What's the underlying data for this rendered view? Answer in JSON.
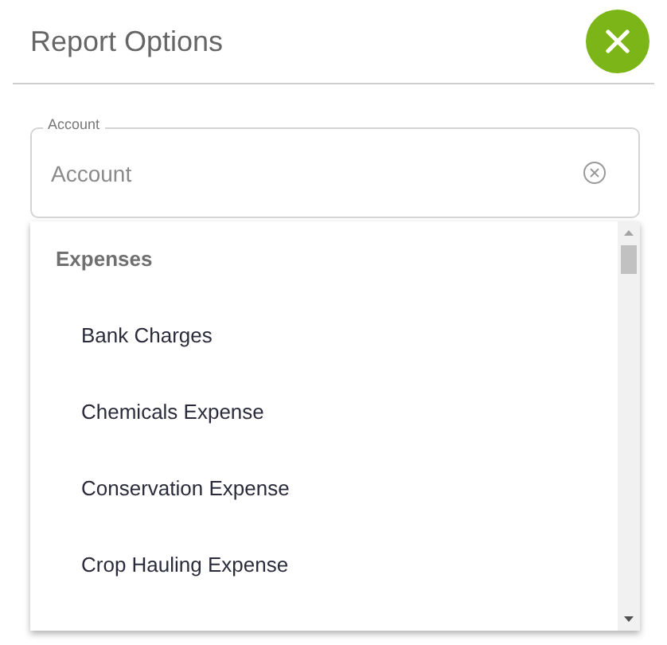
{
  "header": {
    "title": "Report Options"
  },
  "account_field": {
    "label": "Account",
    "placeholder": "Account"
  },
  "dropdown": {
    "groups": [
      {
        "label": "Expenses",
        "items": [
          {
            "label": "Bank Charges"
          },
          {
            "label": "Chemicals Expense"
          },
          {
            "label": "Conservation Expense"
          },
          {
            "label": "Crop Hauling Expense"
          }
        ]
      }
    ]
  }
}
